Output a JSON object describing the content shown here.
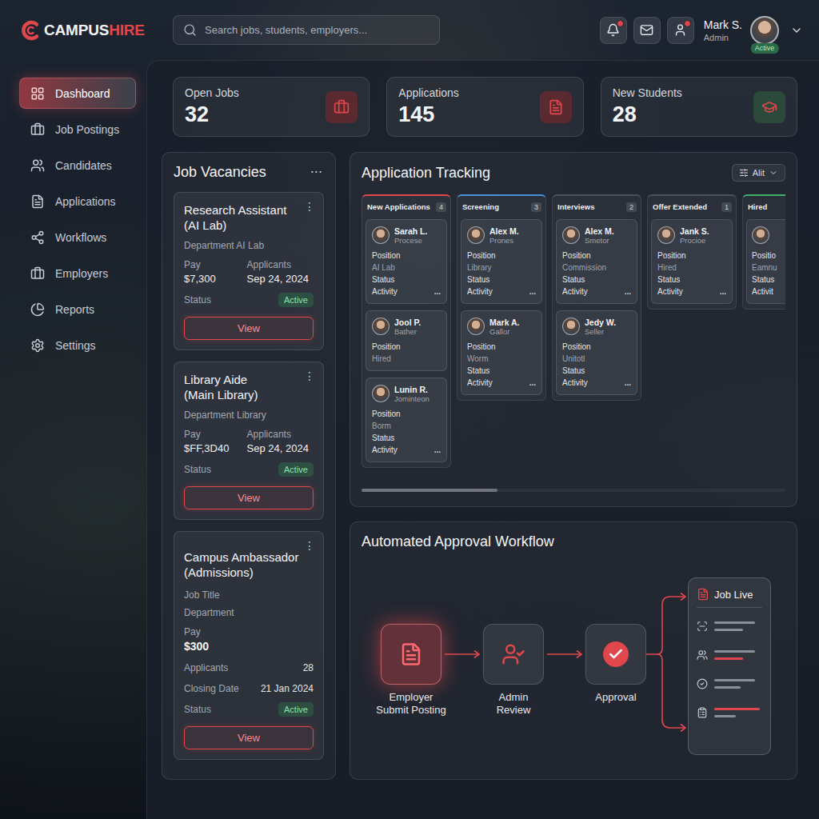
{
  "logo": [
    {
      "text": "CAMPUS",
      "color": "#f2f3f5"
    },
    {
      "text": "HIRE",
      "color": "#e0474c"
    }
  ],
  "search": {
    "placeholder": "Search jobs, students, employers..."
  },
  "header_icons": [
    {
      "badge": true
    },
    {
      "badge": false
    },
    {
      "badge": true
    }
  ],
  "user": {
    "name": "Mark S.",
    "role": "Admin",
    "status": "Active"
  },
  "sidebar": {
    "items": [
      {
        "label": "Dashboard",
        "selected": true
      },
      {
        "label": "Job Postings",
        "selected": false
      },
      {
        "label": "Candidates",
        "selected": false
      },
      {
        "label": "Applications",
        "selected": false
      },
      {
        "label": "Workflows",
        "selected": false
      },
      {
        "label": "Employers",
        "selected": false
      },
      {
        "label": "Reports",
        "selected": false
      },
      {
        "label": "Settings",
        "selected": false
      }
    ]
  },
  "stats": [
    {
      "label": "Open Jobs",
      "value": "32",
      "color": "#5a2a30"
    },
    {
      "label": "Applications",
      "value": "145",
      "color": "#5a2a30"
    },
    {
      "label": "New Students",
      "value": "28",
      "color": "#2c4a3c"
    }
  ],
  "vacancies": {
    "title": "Job Vacancies",
    "menu": "···",
    "jobs": [
      {
        "kind": "grid",
        "title": [
          "Research Assistant",
          "(AI Lab)"
        ],
        "menu": "⋮",
        "subtitle": "Department AI Lab",
        "pay_label": "Pay",
        "pay": "$7,300",
        "applicants_label": "Applicants",
        "applicants": "Sep 24, 2024",
        "status_label": "Status",
        "status": "Active",
        "button": "View"
      },
      {
        "kind": "grid",
        "title": [
          "Library Aide",
          "(Main Library)"
        ],
        "menu": "⋮",
        "subtitle": "Department Library",
        "pay_label": "Pay",
        "pay": "$FF,3D40",
        "applicants_label": "Applicants",
        "applicants": "Sep 24, 2024",
        "status_label": "Status",
        "status": "Active",
        "button": "View"
      },
      {
        "kind": "list",
        "title": [
          "Campus Ambassador",
          "(Admissions)"
        ],
        "menu": "⋮",
        "lines": [
          "Job Title",
          "Department"
        ],
        "pay_label": "Pay",
        "pay": "$300",
        "details": [
          {
            "label": "Applicants",
            "value": "28"
          },
          {
            "label": "Closing Date",
            "value": "21 Jan 2024"
          }
        ],
        "status_label": "Status",
        "status": "Active",
        "button": "View"
      }
    ]
  },
  "tracking": {
    "title": "Application Tracking",
    "filter": "Alit",
    "scroll_level": 0.32,
    "columns": [
      {
        "title": "New Applications",
        "count": "4",
        "color": "#e0474c",
        "kind": "full",
        "cards": [
          {
            "name": "Sarah L.",
            "role": "Procese",
            "menu": "...",
            "lines": [
              {
                "text": "Position",
                "muted": false
              },
              {
                "text": "AI Lab",
                "muted": true
              },
              {
                "text": "Status",
                "muted": false
              },
              {
                "text": "Activity",
                "muted": false
              }
            ]
          },
          {
            "name": "Jool P.",
            "role": "Bather",
            "lines": [
              {
                "text": "Position",
                "muted": false
              },
              {
                "text": "Hired",
                "muted": true
              }
            ]
          },
          {
            "name": "Lunin R.",
            "role": "Jominteon",
            "menu": "...",
            "lines": [
              {
                "text": "Position",
                "muted": false
              },
              {
                "text": "Borm",
                "muted": true
              },
              {
                "text": "Status",
                "muted": false
              },
              {
                "text": "Activity",
                "muted": false
              }
            ]
          }
        ]
      },
      {
        "title": "Screening",
        "count": "3",
        "color": "#4a90d9",
        "kind": "full",
        "cards": [
          {
            "name": "Alex M.",
            "role": "Prones",
            "menu": "...",
            "lines": [
              {
                "text": "Position",
                "muted": false
              },
              {
                "text": "Library",
                "muted": true
              },
              {
                "text": "Status",
                "muted": false
              },
              {
                "text": "Activity",
                "muted": false
              }
            ]
          },
          {
            "name": "Mark A.",
            "role": "Gallor",
            "menu": "...",
            "lines": [
              {
                "text": "Position",
                "muted": false
              },
              {
                "text": "Worm",
                "muted": true
              },
              {
                "text": "Status",
                "muted": false
              },
              {
                "text": "Activity",
                "muted": false
              }
            ]
          }
        ]
      },
      {
        "title": "Interviews",
        "count": "2",
        "color": "#4a505c",
        "kind": "full",
        "cards": [
          {
            "name": "Alex M.",
            "role": "Smetor",
            "menu": "...",
            "lines": [
              {
                "text": "Position",
                "muted": false
              },
              {
                "text": "Commission",
                "muted": true
              },
              {
                "text": "Status",
                "muted": false
              },
              {
                "text": "Activity",
                "muted": false
              }
            ]
          },
          {
            "name": "Jedy W.",
            "role": "Seller",
            "menu": "...",
            "lines": [
              {
                "text": "Position",
                "muted": false
              },
              {
                "text": "Unitotl",
                "muted": true
              },
              {
                "text": "Status",
                "muted": false
              },
              {
                "text": "Activity",
                "muted": false
              }
            ]
          }
        ]
      },
      {
        "title": "Offer Extended",
        "count": "1",
        "color": "#4a505c",
        "kind": "full",
        "cards": [
          {
            "name": "Jank S.",
            "role": "Procioe",
            "menu": "...",
            "lines": [
              {
                "text": "Position",
                "muted": false
              },
              {
                "text": "Hired",
                "muted": true
              },
              {
                "text": "Status",
                "muted": false
              },
              {
                "text": "Activity",
                "muted": false
              }
            ]
          }
        ]
      },
      {
        "title": "Hired",
        "color": "#3fb06a",
        "kind": "partial",
        "cards": [
          {
            "lines": [
              {
                "text": "Positio",
                "muted": false
              },
              {
                "text": "Eamnu",
                "muted": true
              },
              {
                "text": "Status",
                "muted": false
              },
              {
                "text": "Activit",
                "muted": false
              }
            ]
          }
        ]
      }
    ]
  },
  "workflow": {
    "title": "Automated Approval Workflow",
    "steps": [
      {
        "label": [
          "Employer",
          "Submit Posting"
        ],
        "active": true
      },
      {
        "label": [
          "Admin",
          "Review"
        ],
        "active": false
      },
      {
        "label": [
          "Approval"
        ],
        "active": false
      }
    ],
    "result": {
      "title": "Job Live",
      "rows": [
        {
          "bars": [
            {
              "level": 0.85,
              "color": "#8a909b"
            },
            {
              "level": 0.6,
              "color": "#8a909b"
            }
          ]
        },
        {
          "bars": [
            {
              "level": 0.85,
              "color": "#8a909b"
            },
            {
              "level": 0.6,
              "color": "#e0474c"
            }
          ]
        },
        {
          "bars": [
            {
              "level": 0.85,
              "color": "#8a909b"
            },
            {
              "level": 0.55,
              "color": "#8a909b"
            }
          ]
        },
        {
          "bars": [
            {
              "level": 0.95,
              "color": "#e0474c"
            },
            {
              "level": 0.45,
              "color": "#8a909b"
            }
          ]
        }
      ]
    }
  }
}
